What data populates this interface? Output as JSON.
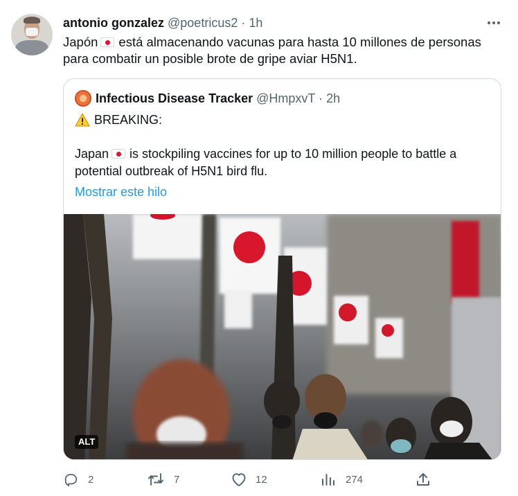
{
  "tweet": {
    "author_name": "antonio gonzalez",
    "author_handle": "@poetricus2",
    "separator": "·",
    "time": "1h",
    "text_part1": "Japón",
    "text_part2": "está almacenando vacunas para hasta 10 millones de personas para combatir un posible brote de gripe aviar H5N1."
  },
  "quote": {
    "author_name": "Infectious Disease Tracker",
    "author_handle": "@HmpxvT",
    "separator": "·",
    "time": "2h",
    "breaking": "BREAKING:",
    "body_part1": "Japan",
    "body_part2": "is stockpiling vaccines for up to 10 million people to battle a potential outbreak of H5N1 bird flu.",
    "show_thread": "Mostrar este hilo",
    "alt_badge": "ALT"
  },
  "actions": {
    "replies": "2",
    "retweets": "7",
    "likes": "12",
    "views": "274"
  },
  "icons": {
    "more": "more-horizontal-icon",
    "reply": "reply-icon",
    "retweet": "retweet-icon",
    "like": "heart-icon",
    "views": "views-icon",
    "share": "share-icon",
    "warning": "warning-icon",
    "flag": "japan-flag-icon"
  },
  "colors": {
    "link": "#1d9bf0",
    "muted": "#536471",
    "text": "#0f1419",
    "border": "#cfd9de",
    "flag_red": "#e0132e"
  }
}
